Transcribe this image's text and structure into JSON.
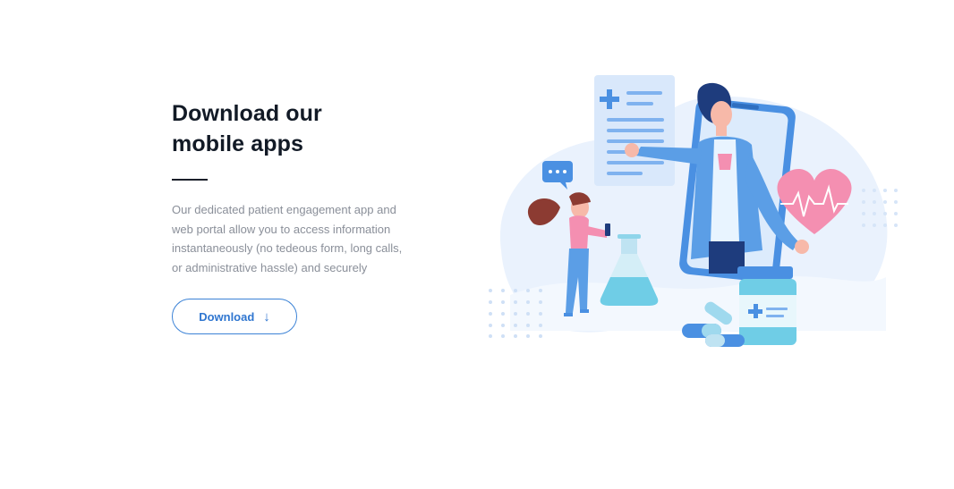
{
  "section": {
    "heading": "Download our\nmobile apps",
    "description": "Our dedicated patient engagement app and web portal allow you to access information instantaneously (no tedeous form, long calls, or administrative hassle) and securely",
    "download_label": "Download",
    "download_icon": "arrow-down-icon"
  },
  "colors": {
    "accent": "#2f76d0",
    "heading": "#121a26",
    "body_text": "#8a8f99",
    "illustration_blue": "#4a90e2",
    "illustration_pink": "#f48fb1"
  }
}
